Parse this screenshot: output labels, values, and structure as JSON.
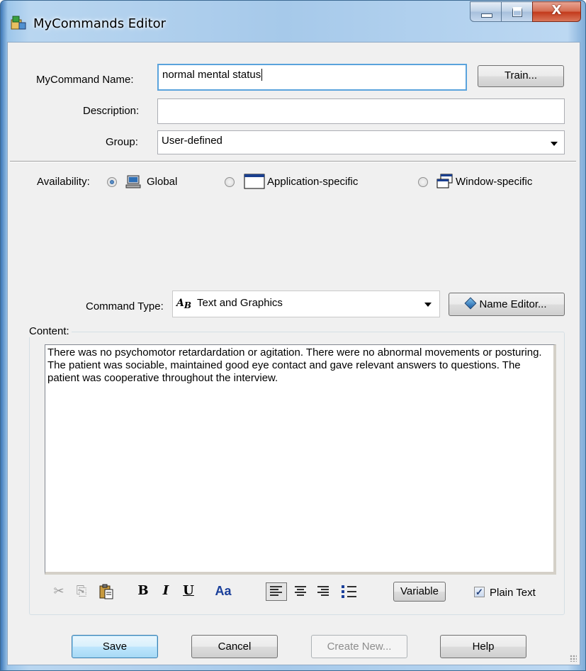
{
  "window": {
    "title": "MyCommands Editor"
  },
  "form": {
    "name_label": "MyCommand Name:",
    "name_value": "normal mental status",
    "train_button": "Train...",
    "description_label": "Description:",
    "description_value": "",
    "group_label": "Group:",
    "group_value": "User-defined",
    "availability_label": "Availability:",
    "availability_options": [
      "Global",
      "Application-specific",
      "Window-specific"
    ],
    "availability_selected": "Global",
    "command_type_label": "Command Type:",
    "command_type_value": "Text and Graphics",
    "name_editor_button": "Name Editor..."
  },
  "content": {
    "label": "Content:",
    "text": "There was no psychomotor retardardation or agitation. There were no abnormal movements or posturing. The patient was sociable, maintained good eye contact and gave relevant answers to questions. The patient was cooperative throughout the interview."
  },
  "toolbar": {
    "cut_icon": "scissors-icon",
    "copy_icon": "copy-icon",
    "paste_icon": "paste-icon",
    "bold": "B",
    "italic": "I",
    "underline": "U",
    "font": "Aa",
    "variable_button": "Variable",
    "plain_text_label": "Plain Text",
    "plain_text_checked": true
  },
  "buttons": {
    "save": "Save",
    "cancel": "Cancel",
    "create_new": "Create New...",
    "help": "Help"
  }
}
